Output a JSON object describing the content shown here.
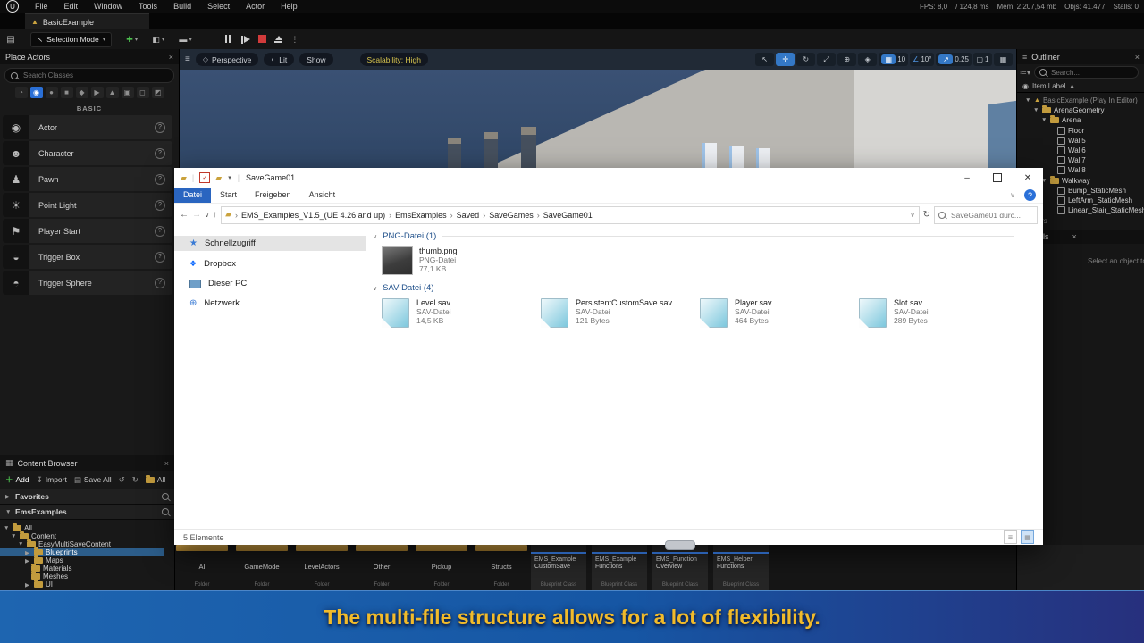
{
  "menu": {
    "items": [
      "File",
      "Edit",
      "Window",
      "Tools",
      "Build",
      "Select",
      "Actor",
      "Help"
    ],
    "stats": [
      "FPS: 8,0",
      "/ 124,8 ms",
      "Mem: 2.207,54 mb",
      "Objs: 41.477",
      "Stalls: 0"
    ]
  },
  "level_tab": {
    "label": "BasicExample"
  },
  "main_toolbar": {
    "mode_label": "Selection Mode"
  },
  "place_actors": {
    "title": "Place Actors",
    "search_placeholder": "Search Classes",
    "section_label": "BASIC",
    "items": [
      "Actor",
      "Character",
      "Pawn",
      "Point Light",
      "Player Start",
      "Trigger Box",
      "Trigger Sphere"
    ]
  },
  "viewport": {
    "perspective_label": "Perspective",
    "lit_label": "Lit",
    "show_label": "Show",
    "scalability_label": "Scalability: High",
    "grid_snap": "10",
    "rotation_snap": "10°",
    "scale_snap": "0.25",
    "camera_speed": "1"
  },
  "outliner": {
    "title": "Outliner",
    "search_placeholder": "Search...",
    "column_header": "Item Label",
    "tree": [
      {
        "label": "BasicExample (Play In Editor)"
      },
      {
        "label": "ArenaGeometry"
      },
      {
        "label": "Arena"
      },
      {
        "label": "Floor"
      },
      {
        "label": "Wall5"
      },
      {
        "label": "Wall6"
      },
      {
        "label": "Wall7"
      },
      {
        "label": "Wall8"
      },
      {
        "label": "Walkway"
      },
      {
        "label": "Bump_StaticMesh"
      },
      {
        "label": "LeftArm_StaticMesh"
      },
      {
        "label": "Linear_Stair_StaticMesh"
      }
    ],
    "footer": "actors"
  },
  "details": {
    "title": "Details",
    "empty_text": "Select an object to view details."
  },
  "explorer": {
    "window_title": "SaveGame01",
    "ribbon_tabs": [
      "Datei",
      "Start",
      "Freigeben",
      "Ansicht"
    ],
    "breadcrumb": [
      "EMS_Examples_V1.5_(UE 4.26 and up)",
      "EmsExamples",
      "Saved",
      "SaveGames",
      "SaveGame01"
    ],
    "search_placeholder": "SaveGame01 durc...",
    "sidebar": [
      {
        "label": "Schnellzugriff"
      },
      {
        "label": "Dropbox"
      },
      {
        "label": "Dieser PC"
      },
      {
        "label": "Netzwerk"
      }
    ],
    "groups": [
      {
        "title": "PNG-Datei (1)",
        "files": [
          {
            "name": "thumb.png",
            "type": "PNG-Datei",
            "size": "77,1 KB"
          }
        ]
      },
      {
        "title": "SAV-Datei (4)",
        "files": [
          {
            "name": "Level.sav",
            "type": "SAV-Datei",
            "size": "14,5 KB"
          },
          {
            "name": "PersistentCustomSave.sav",
            "type": "SAV-Datei",
            "size": "121 Bytes"
          },
          {
            "name": "Player.sav",
            "type": "SAV-Datei",
            "size": "464 Bytes"
          },
          {
            "name": "Slot.sav",
            "type": "SAV-Datei",
            "size": "289 Bytes"
          }
        ]
      }
    ],
    "status_text": "5 Elemente"
  },
  "content_browser": {
    "title": "Content Browser",
    "add_label": "Add",
    "import_label": "Import",
    "save_all_label": "Save All",
    "path_label": "All",
    "favorites_label": "Favorites",
    "collection_label": "EmsExamples",
    "tree": [
      {
        "label": "All"
      },
      {
        "label": "Content"
      },
      {
        "label": "EasyMultiSaveContent"
      },
      {
        "label": "Blueprints"
      },
      {
        "label": "Maps"
      },
      {
        "label": "Materials"
      },
      {
        "label": "Meshes"
      },
      {
        "label": "UI"
      }
    ]
  },
  "assets": {
    "folders": [
      "AI",
      "GameMode",
      "LevelActors",
      "Other",
      "Pickup",
      "Structs"
    ],
    "folder_type": "Folder",
    "blueprints": [
      {
        "l1": "EMS_Example",
        "l2": "CustomSave"
      },
      {
        "l1": "EMS_Example",
        "l2": "Functions"
      },
      {
        "l1": "EMS_Function",
        "l2": "Overview"
      },
      {
        "l1": "EMS_Helper",
        "l2": "Functions"
      }
    ],
    "blueprint_type": "Blueprint Class"
  },
  "subtitle": {
    "text": "The multi-file structure allows for a lot of flexibility."
  },
  "colors": {
    "accent_blue": "#2a6fd6",
    "selection_blue": "#2c5d8a",
    "scalability_yellow": "#d9c64e",
    "subtitle_gold": "#f1bb2b",
    "explorer_tab_blue": "#2a65c0"
  }
}
